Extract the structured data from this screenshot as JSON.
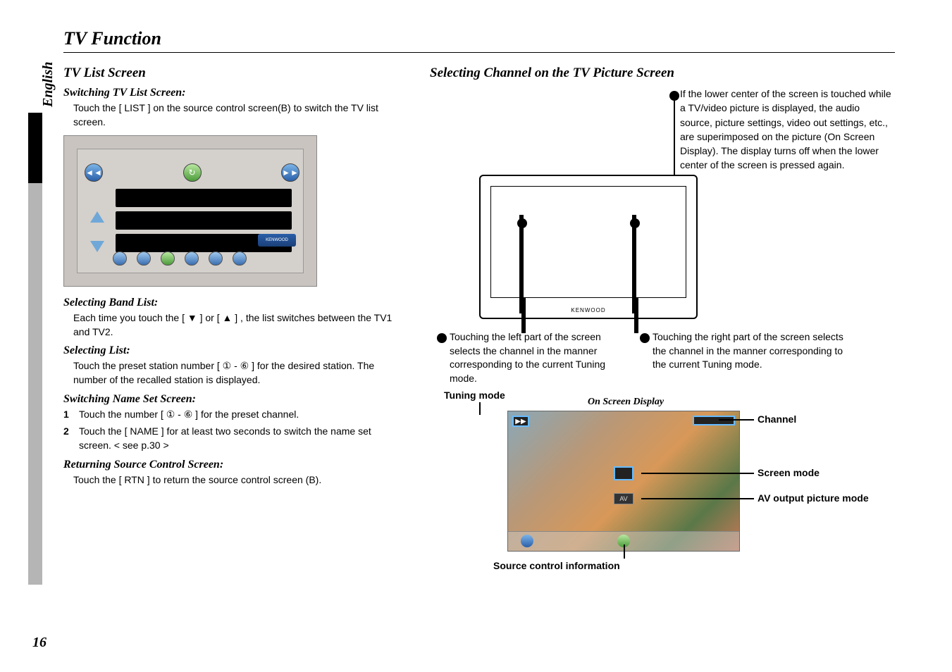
{
  "language_tab": "English",
  "page_number": "16",
  "title": "TV Function",
  "left": {
    "h2": "TV List Screen",
    "switching": {
      "h3": "Switching TV List Screen:",
      "body": "Touch the [ LIST ] on the source control screen(B) to switch the TV list screen."
    },
    "band": {
      "h3": "Selecting Band List:",
      "body": "Each time you touch the  [ ▼ ] or [ ▲ ] , the list switches between the TV1 and TV2."
    },
    "list": {
      "h3": "Selecting List:",
      "body": "Touch the preset station number  [ ① - ⑥ ] for the desired station. The number of the recalled station is displayed."
    },
    "name": {
      "h3": "Switching Name Set Screen:",
      "step1_num": "1",
      "step1": "Touch the number  [ ① - ⑥ ] for the preset channel.",
      "step2_num": "2",
      "step2": "Touch the [ NAME ]  for at least two seconds to switch the name set screen. < see p.30 >"
    },
    "return": {
      "h3": "Returning Source Control Screen:",
      "body": "Touch the [ RTN ] to return the source control screen (B)."
    },
    "kenwood": "KENWOOD"
  },
  "right": {
    "h2": "Selecting Channel on the TV Picture Screen",
    "intro": "If the lower center of the screen is touched while a TV/video picture is displayed, the audio source, picture settings, video out settings, etc., are superimposed on the picture (On Screen Display). The display turns off when the lower center of the screen is pressed again.",
    "left_desc": "Touching the left part of the screen selects the channel in the manner corresponding to the current Tuning mode.",
    "right_desc": "Touching the right part of the screen selects the channel in the manner corresponding to the current Tuning mode.",
    "tuning_label": "Tuning mode",
    "osd_label": "On Screen Display",
    "channel_label": "Channel",
    "screen_mode_label": "Screen mode",
    "av_label": "AV output picture mode",
    "source_label": "Source control information",
    "brand": "KENWOOD",
    "av_text": "AV",
    "ff": "▶▶"
  }
}
